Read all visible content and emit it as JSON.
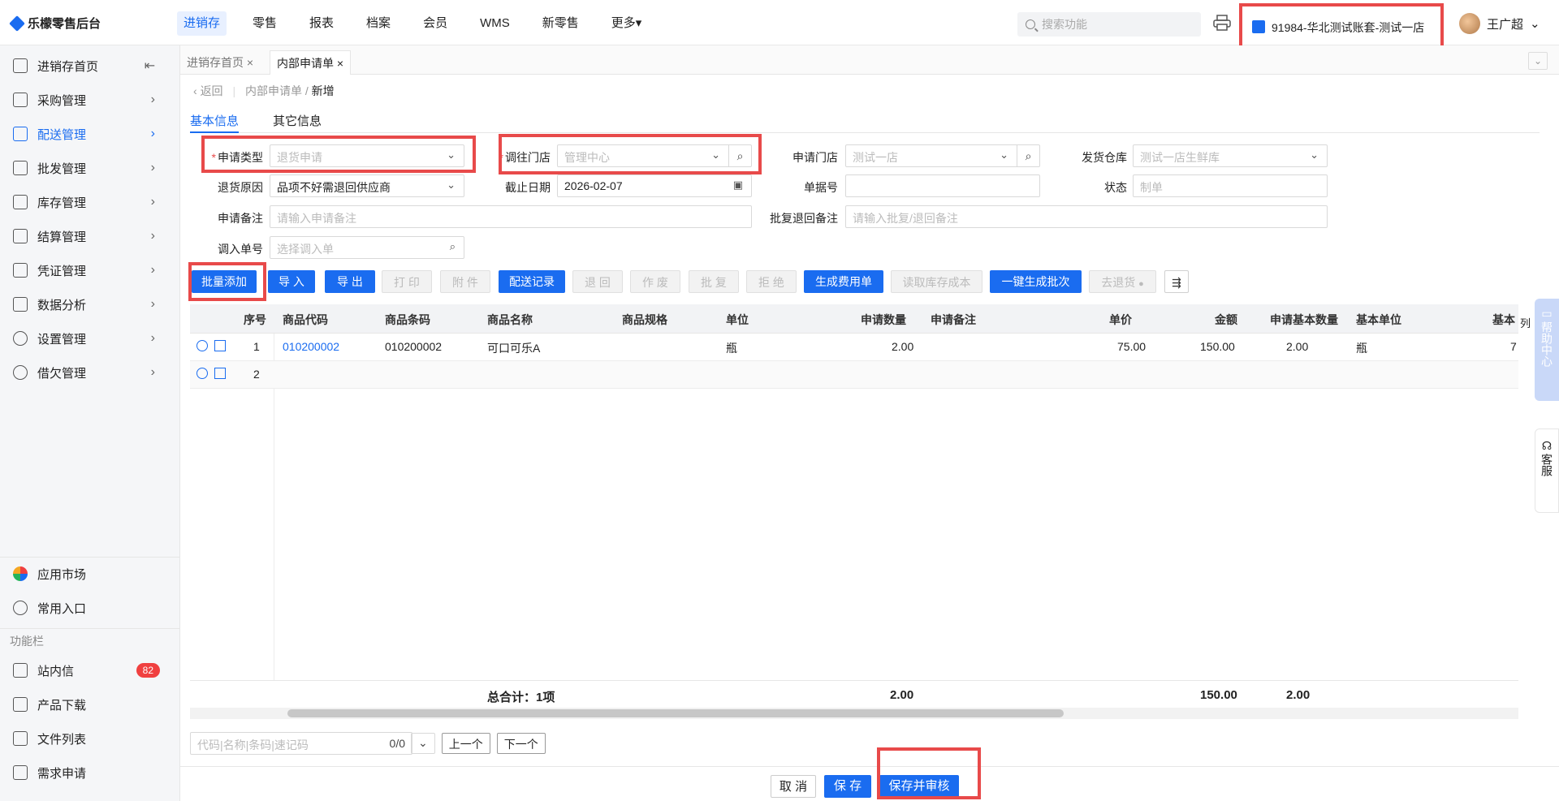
{
  "app": {
    "title": "乐檬零售后台"
  },
  "topnav": [
    "进销存",
    "零售",
    "报表",
    "档案",
    "会员",
    "WMS",
    "新零售",
    "更多"
  ],
  "search": {
    "placeholder": "搜索功能"
  },
  "account": "91984-华北测试账套-测试一店",
  "user": "王广超",
  "sidebar": {
    "items": [
      {
        "label": "进销存首页"
      },
      {
        "label": "采购管理"
      },
      {
        "label": "配送管理"
      },
      {
        "label": "批发管理"
      },
      {
        "label": "库存管理"
      },
      {
        "label": "结算管理"
      },
      {
        "label": "凭证管理"
      },
      {
        "label": "数据分析"
      },
      {
        "label": "设置管理"
      },
      {
        "label": "借欠管理"
      }
    ],
    "bottom": [
      {
        "label": "应用市场"
      },
      {
        "label": "常用入口"
      }
    ],
    "section": "功能栏",
    "func": [
      {
        "label": "站内信",
        "badge": "82"
      },
      {
        "label": "产品下载"
      },
      {
        "label": "文件列表"
      },
      {
        "label": "需求申请"
      }
    ]
  },
  "tabs": [
    "进销存首页",
    "内部申请单"
  ],
  "breadcrumb": {
    "back": "返回",
    "parent": "内部申请单",
    "current": "新增"
  },
  "subtabs": [
    "基本信息",
    "其它信息"
  ],
  "form": {
    "apply_type": {
      "label": "申请类型",
      "value": "退货申请"
    },
    "to_store": {
      "label": "调往门店",
      "placeholder": "管理中心"
    },
    "apply_store": {
      "label": "申请门店",
      "placeholder": "测试一店"
    },
    "warehouse": {
      "label": "发货仓库",
      "placeholder": "测试一店生鲜库"
    },
    "return_reason": {
      "label": "退货原因",
      "value": "品项不好需退回供应商"
    },
    "deadline": {
      "label": "截止日期",
      "value": "2026-02-07"
    },
    "doc_no": {
      "label": "单据号",
      "value": ""
    },
    "status": {
      "label": "状态",
      "placeholder": "制单"
    },
    "remark": {
      "label": "申请备注",
      "placeholder": "请输入申请备注"
    },
    "reply_remark": {
      "label": "批复退回备注",
      "placeholder": "请输入批复/退回备注"
    },
    "in_doc": {
      "label": "调入单号",
      "placeholder": "选择调入单"
    }
  },
  "toolbar": {
    "batch_add": "批量添加",
    "import": "导 入",
    "export": "导 出",
    "print": "打 印",
    "attach": "附 件",
    "record": "配送记录",
    "return": "退 回",
    "void": "作 废",
    "approve": "批 复",
    "reject": "拒 绝",
    "gen_fee": "生成费用单",
    "read_cost": "读取库存成本",
    "gen_batch": "一键生成批次",
    "go_return": "去退货"
  },
  "grid": {
    "headers": [
      "序号",
      "商品代码",
      "商品条码",
      "商品名称",
      "商品规格",
      "单位",
      "申请数量",
      "申请备注",
      "单价",
      "金额",
      "申请基本数量",
      "基本单位",
      "基本"
    ],
    "rows": [
      {
        "no": "1",
        "code": "010200002",
        "barcode": "010200002",
        "name": "可口可乐A",
        "spec": "",
        "unit": "瓶",
        "qty": "2.00",
        "remark": "",
        "price": "75.00",
        "amount": "150.00",
        "base_qty": "2.00",
        "base_unit": "瓶",
        "extra": "7"
      },
      {
        "no": "2"
      }
    ],
    "total_label": "总合计：1项",
    "total_qty": "2.00",
    "total_amount": "150.00",
    "total_base_qty": "2.00"
  },
  "pager": {
    "placeholder": "代码|名称|条码|速记码",
    "count": "0/0",
    "prev": "上一个",
    "next": "下一个"
  },
  "footer": {
    "cancel": "取 消",
    "save": "保 存",
    "save_audit": "保存并审核"
  },
  "dock": {
    "help": "帮助中心",
    "service": "客服",
    "list": "列"
  }
}
